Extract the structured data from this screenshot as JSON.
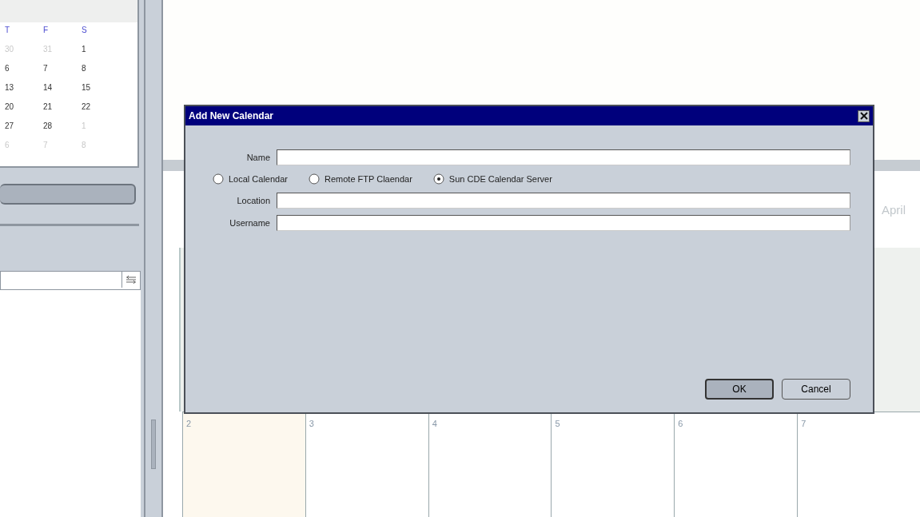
{
  "mini_calendar": {
    "weekdays": [
      "T",
      "F",
      "S"
    ],
    "weeks": [
      [
        {
          "day": "30",
          "muted": true
        },
        {
          "day": "31",
          "muted": true
        },
        {
          "day": "1",
          "muted": false
        }
      ],
      [
        {
          "day": "6",
          "muted": false
        },
        {
          "day": "7",
          "muted": false
        },
        {
          "day": "8",
          "muted": false
        }
      ],
      [
        {
          "day": "13",
          "muted": false
        },
        {
          "day": "14",
          "muted": false
        },
        {
          "day": "15",
          "muted": false
        }
      ],
      [
        {
          "day": "20",
          "muted": false
        },
        {
          "day": "21",
          "muted": false
        },
        {
          "day": "22",
          "muted": false
        }
      ],
      [
        {
          "day": "27",
          "muted": false
        },
        {
          "day": "28",
          "muted": false
        },
        {
          "day": "1",
          "muted": true
        }
      ],
      [
        {
          "day": "6",
          "muted": true
        },
        {
          "day": "7",
          "muted": true
        },
        {
          "day": "8",
          "muted": true
        }
      ]
    ]
  },
  "month_view": {
    "month_label": "April",
    "days": [
      {
        "label": "2",
        "today": true
      },
      {
        "label": "3",
        "today": false
      },
      {
        "label": "4",
        "today": false
      },
      {
        "label": "5",
        "today": false
      },
      {
        "label": "6",
        "today": false
      },
      {
        "label": "7",
        "today": false
      }
    ]
  },
  "dialog": {
    "title": "Add New Calendar",
    "name_field": {
      "label": "Name"
    },
    "calendar_types": [
      {
        "label": "Local Calendar",
        "selected": false
      },
      {
        "label": "Remote FTP Claendar",
        "selected": false
      },
      {
        "label": "Sun CDE Calendar Server",
        "selected": true
      }
    ],
    "location_field": {
      "label": "Location"
    },
    "username_field": {
      "label": "Username"
    },
    "buttons": [
      {
        "label": "OK",
        "default": true
      },
      {
        "label": "Cancel",
        "default": false
      }
    ]
  }
}
